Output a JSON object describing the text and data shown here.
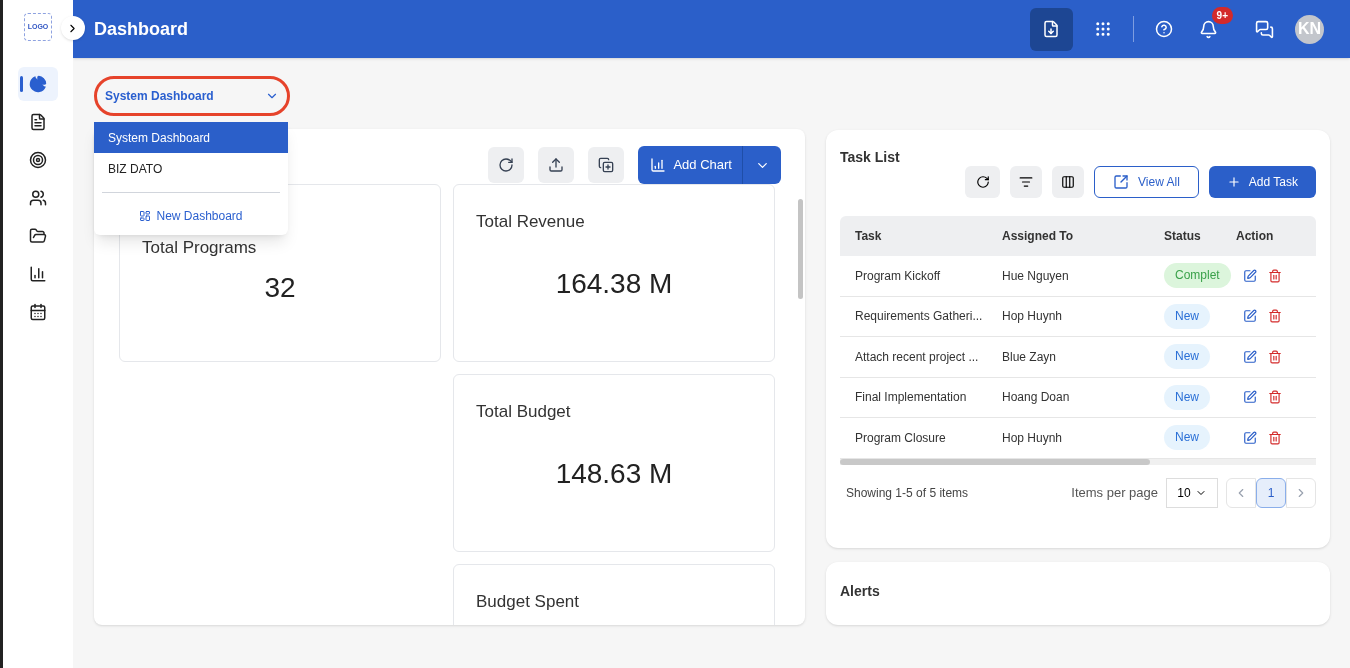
{
  "sidebar": {
    "logo": "LOGO",
    "items": [
      {
        "selected": true
      },
      {
        "selected": false
      },
      {
        "selected": false
      },
      {
        "selected": false
      },
      {
        "selected": false
      },
      {
        "selected": false
      },
      {
        "selected": false
      }
    ]
  },
  "header": {
    "title": "Dashboard",
    "notification_count": "9+",
    "avatar": "KN"
  },
  "dashboard_select": {
    "value": "System Dashboard",
    "expanded": true,
    "options": [
      {
        "label": "System Dashboard",
        "selected": true
      },
      {
        "label": "BIZ DATO",
        "selected": false
      }
    ],
    "new_label": "New Dashboard"
  },
  "toolbar": {
    "add_chart": "Add Chart"
  },
  "stats": [
    {
      "title": "Total Programs",
      "value": "32"
    },
    {
      "title": "Total Revenue",
      "value": "164.38 M"
    },
    {
      "title": "Total Budget",
      "value": "148.63 M"
    },
    {
      "title": "Budget Spent"
    }
  ],
  "task_list": {
    "title": "Task List",
    "view_all": "View All",
    "add_task": "Add Task",
    "columns": [
      "Task",
      "Assigned To",
      "Status",
      "Action"
    ],
    "rows": [
      {
        "task": "Program Kickoff",
        "assigned": "Hue Nguyen",
        "status": "Complet",
        "kind": "complete"
      },
      {
        "task": "Requirements Gatheri...",
        "assigned": "Hop Huynh",
        "status": "New",
        "kind": "new"
      },
      {
        "task": "Attach recent project ...",
        "assigned": "Blue Zayn",
        "status": "New",
        "kind": "new"
      },
      {
        "task": "Final Implementation",
        "assigned": "Hoang Doan",
        "status": "New",
        "kind": "new"
      },
      {
        "task": "Program Closure",
        "assigned": "Hop Huynh",
        "status": "New",
        "kind": "new"
      }
    ],
    "showing": "Showing 1-5 of 5 items",
    "per_page_label": "Items per page",
    "per_page": "10",
    "pages": [
      {
        "label": "1",
        "selected": true
      }
    ]
  },
  "alerts": {
    "title": "Alerts"
  }
}
